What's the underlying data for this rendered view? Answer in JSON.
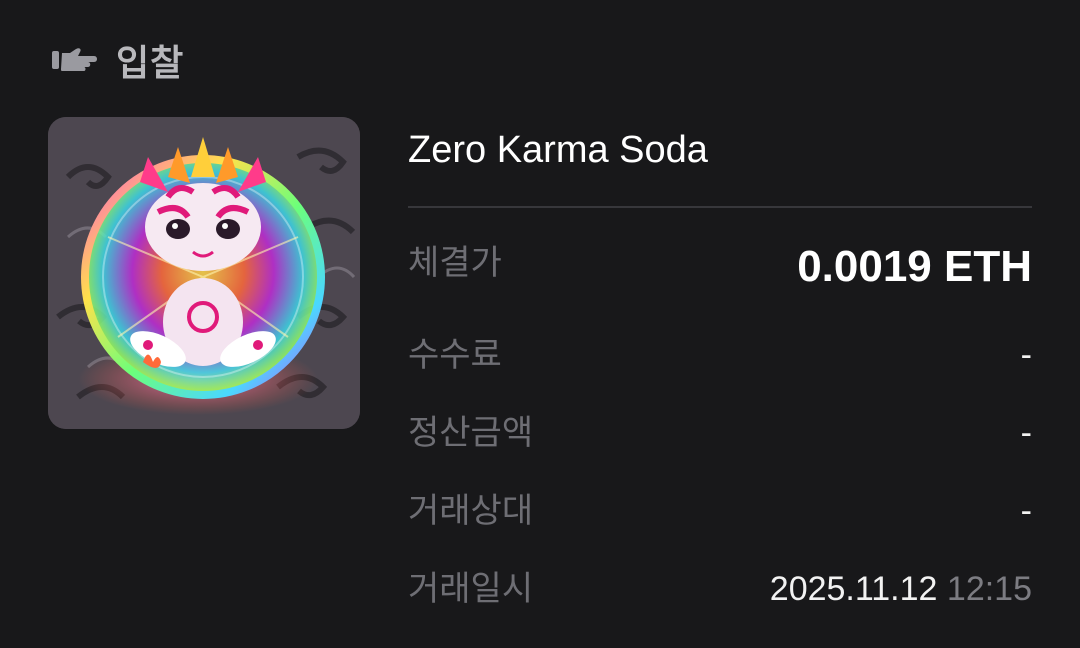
{
  "header": {
    "icon": "hand-point-icon",
    "title": "입찰"
  },
  "item": {
    "name": "Zero Karma Soda",
    "image": "nft-artwork-image"
  },
  "details": {
    "price": {
      "label": "체결가",
      "value": "0.0019 ETH"
    },
    "fee": {
      "label": "수수료",
      "value": "-"
    },
    "settlement": {
      "label": "정산금액",
      "value": "-"
    },
    "counterparty": {
      "label": "거래상대",
      "value": "-"
    },
    "datetime": {
      "label": "거래일시",
      "date": "2025.11.12",
      "time": "12:15"
    }
  },
  "colors": {
    "background": "#18181a",
    "label": "#6e6e74",
    "value": "#ffffff",
    "time": "#7c7c82",
    "header": "#b8b8bc"
  }
}
